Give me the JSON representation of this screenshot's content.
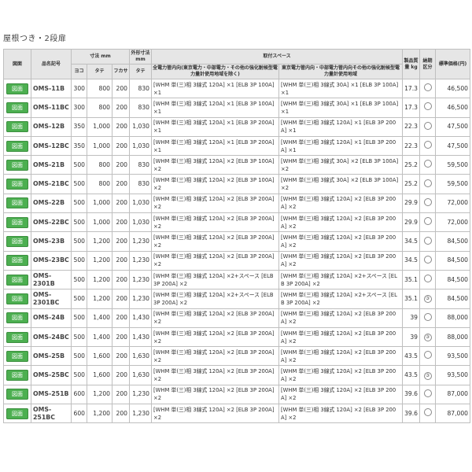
{
  "section_title": "屋根つき・2段扉",
  "headers": {
    "zumen": "図面",
    "model": "品名記号",
    "size": "寸法 mm",
    "yoko": "ヨコ",
    "tate": "タテ",
    "fukasa": "フカサ",
    "outer": "外形寸法 mm",
    "outer_tate": "タテ",
    "mount": "取付スペース",
    "tepco": "全電力管内向(東京電力・中部電力・その他の強化耐候型電力量計使用地域を除く)",
    "other": "東京電力管内向・中部電力管内向その他の強化耐候型電力量計使用地域",
    "weight": "製品質量 kg",
    "delivery": "納期区分",
    "price": "標準価格(円)"
  },
  "button_label": "図面",
  "rows": [
    {
      "model": "OMS-11B",
      "w": "300",
      "h": "800",
      "d": "200",
      "oh": "830",
      "sp1": "[WHM 単(三)相 3線式 120A] ×1 [ELB 3P 100A] ×1",
      "sp2": "[WHM 単(三)相 3線式 30A] ×1 [ELB 3P 100A] ×1",
      "kg": "17.3",
      "del": "",
      "price": "46,500"
    },
    {
      "model": "OMS-11BC",
      "w": "300",
      "h": "800",
      "d": "200",
      "oh": "830",
      "sp1": "[WHM 単(三)相 3線式 120A] ×1 [ELB 3P 100A] ×1",
      "sp2": "[WHM 単(三)相 3線式 30A] ×1 [ELB 3P 100A] ×1",
      "kg": "17.3",
      "del": "",
      "price": "46,500"
    },
    {
      "model": "OMS-12B",
      "w": "350",
      "h": "1,000",
      "d": "200",
      "oh": "1,030",
      "sp1": "[WHM 単(三)相 3線式 120A] ×1 [ELB 3P 200A] ×1",
      "sp2": "[WHM 単(三)相 3線式 120A] ×1 [ELB 3P 200A] ×1",
      "kg": "22.3",
      "del": "",
      "price": "47,500"
    },
    {
      "model": "OMS-12BC",
      "w": "350",
      "h": "1,000",
      "d": "200",
      "oh": "1,030",
      "sp1": "[WHM 単(三)相 3線式 120A] ×1 [ELB 3P 200A] ×1",
      "sp2": "[WHM 単(三)相 3線式 120A] ×1 [ELB 3P 200A] ×1",
      "kg": "22.3",
      "del": "",
      "price": "47,500"
    },
    {
      "model": "OMS-21B",
      "w": "500",
      "h": "800",
      "d": "200",
      "oh": "830",
      "sp1": "[WHM 単(三)相 3線式 120A] ×2 [ELB 3P 100A] ×2",
      "sp2": "[WHM 単(三)相 3線式 30A] ×2 [ELB 3P 100A] ×2",
      "kg": "25.2",
      "del": "",
      "price": "59,500"
    },
    {
      "model": "OMS-21BC",
      "w": "500",
      "h": "800",
      "d": "200",
      "oh": "830",
      "sp1": "[WHM 単(三)相 3線式 120A] ×2 [ELB 3P 100A] ×2",
      "sp2": "[WHM 単(三)相 3線式 30A] ×2 [ELB 3P 100A] ×2",
      "kg": "25.2",
      "del": "",
      "price": "59,500"
    },
    {
      "model": "OMS-22B",
      "w": "500",
      "h": "1,000",
      "d": "200",
      "oh": "1,030",
      "sp1": "[WHM 単(三)相 3線式 120A] ×2 [ELB 3P 200A] ×2",
      "sp2": "[WHM 単(三)相 3線式 120A] ×2 [ELB 3P 200A] ×2",
      "kg": "29.9",
      "del": "",
      "price": "72,000"
    },
    {
      "model": "OMS-22BC",
      "w": "500",
      "h": "1,000",
      "d": "200",
      "oh": "1,030",
      "sp1": "[WHM 単(三)相 3線式 120A] ×2 [ELB 3P 200A] ×2",
      "sp2": "[WHM 単(三)相 3線式 120A] ×2 [ELB 3P 200A] ×2",
      "kg": "29.9",
      "del": "",
      "price": "72,000"
    },
    {
      "model": "OMS-23B",
      "w": "500",
      "h": "1,200",
      "d": "200",
      "oh": "1,230",
      "sp1": "[WHM 単(三)相 3線式 120A] ×2 [ELB 3P 200A] ×2",
      "sp2": "[WHM 単(三)相 3線式 120A] ×2 [ELB 3P 200A] ×2",
      "kg": "34.5",
      "del": "",
      "price": "84,500"
    },
    {
      "model": "OMS-23BC",
      "w": "500",
      "h": "1,200",
      "d": "200",
      "oh": "1,230",
      "sp1": "[WHM 単(三)相 3線式 120A] ×2 [ELB 3P 200A] ×2",
      "sp2": "[WHM 単(三)相 3線式 120A] ×2 [ELB 3P 200A] ×2",
      "kg": "34.5",
      "del": "",
      "price": "84,500"
    },
    {
      "model": "OMS-2301B",
      "w": "500",
      "h": "1,200",
      "d": "200",
      "oh": "1,230",
      "sp1": "[WHM 単(三)相 3線式 120A] ×2+スペース [ELB 3P 200A] ×2",
      "sp2": "[WHM 単(三)相 3線式 120A] ×2+スペース [ELB 3P 200A] ×2",
      "kg": "35.1",
      "del": "",
      "price": "84,500"
    },
    {
      "model": "OMS-2301BC",
      "w": "500",
      "h": "1,200",
      "d": "200",
      "oh": "1,230",
      "sp1": "[WHM 単(三)相 3線式 120A] ×2+スペース [ELB 3P 200A] ×2",
      "sp2": "[WHM 単(三)相 3線式 120A] ×2+スペース [ELB 3P 200A] ×2",
      "kg": "35.1",
      "del": "③",
      "price": "84,500"
    },
    {
      "model": "OMS-24B",
      "w": "500",
      "h": "1,400",
      "d": "200",
      "oh": "1,430",
      "sp1": "[WHM 単(三)相 3線式 120A] ×2 [ELB 3P 200A] ×2",
      "sp2": "[WHM 単(三)相 3線式 120A] ×2 [ELB 3P 200A] ×2",
      "kg": "39",
      "del": "",
      "price": "88,000"
    },
    {
      "model": "OMS-24BC",
      "w": "500",
      "h": "1,400",
      "d": "200",
      "oh": "1,430",
      "sp1": "[WHM 単(三)相 3線式 120A] ×2 [ELB 3P 200A] ×2",
      "sp2": "[WHM 単(三)相 3線式 120A] ×2 [ELB 3P 200A] ×2",
      "kg": "39",
      "del": "③",
      "price": "88,000"
    },
    {
      "model": "OMS-25B",
      "w": "500",
      "h": "1,600",
      "d": "200",
      "oh": "1,630",
      "sp1": "[WHM 単(三)相 3線式 120A] ×2 [ELB 3P 200A] ×2",
      "sp2": "[WHM 単(三)相 3線式 120A] ×2 [ELB 3P 200A] ×2",
      "kg": "43.5",
      "del": "",
      "price": "93,500"
    },
    {
      "model": "OMS-25BC",
      "w": "500",
      "h": "1,600",
      "d": "200",
      "oh": "1,630",
      "sp1": "[WHM 単(三)相 3線式 120A] ×2 [ELB 3P 200A] ×2",
      "sp2": "[WHM 単(三)相 3線式 120A] ×2 [ELB 3P 200A] ×2",
      "kg": "43.5",
      "del": "③",
      "price": "93,500"
    },
    {
      "model": "OMS-251B",
      "w": "600",
      "h": "1,200",
      "d": "200",
      "oh": "1,230",
      "sp1": "[WHM 単(三)相 3線式 120A] ×2 [ELB 3P 200A] ×2",
      "sp2": "[WHM 単(三)相 3線式 120A] ×2 [ELB 3P 200A] ×2",
      "kg": "39.6",
      "del": "",
      "price": "87,000"
    },
    {
      "model": "OMS-251BC",
      "w": "600",
      "h": "1,200",
      "d": "200",
      "oh": "1,230",
      "sp1": "[WHM 単(三)相 3線式 120A] ×2 [ELB 3P 200A] ×2",
      "sp2": "[WHM 単(三)相 3線式 120A] ×2 [ELB 3P 200A] ×2",
      "kg": "39.6",
      "del": "",
      "price": "87,000"
    }
  ]
}
